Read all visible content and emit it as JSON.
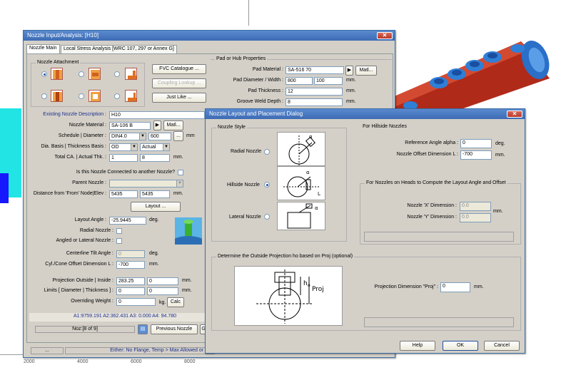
{
  "background": {
    "axis_ticks": [
      "2000",
      "4000",
      "6000",
      "8000"
    ]
  },
  "nozzle_window": {
    "title": "Nozzle Input/Analysis:  [H10]",
    "tabs": [
      "Nozzle Main",
      "Local Stress Analysis [WRC 107, 297 or Annex G]"
    ],
    "attachment_group": "Nozzle Attachment",
    "buttons": {
      "fvc": "FVC Catalogue ...",
      "coupling": "Coupling Lookup ...",
      "just_like": "Just Like ...",
      "layout": "Layout ...",
      "calc": "Calc",
      "prev": "Previous Nozzle",
      "next_partial": "Go",
      "matl": "Matl...",
      "ellipsis": "..."
    },
    "pad_group": "Pad or Hub Properties",
    "pad_material_label": "Pad Material :",
    "pad_material_value": "SA-516 70",
    "pad_diameter_label": "Pad Diameter / Width :",
    "pad_diameter_value": "800",
    "pad_width_value": "100",
    "pad_thickness_label": "Pad Thickness :",
    "pad_thickness_value": "12",
    "groove_label": "Groove Weld Depth :",
    "groove_value": "8",
    "unit_mm": "mm.",
    "unit_mm_short": "mm",
    "existing_label": "Existing Nozzle Description :",
    "existing_value": "H10",
    "material_label": "Nozzle Material :",
    "material_value": "SA-106 B",
    "schedule_label": "Schedule | Diameter :",
    "schedule_value": "DIN4.0",
    "diameter_value": "600",
    "dia_basis_label": "Dia. Basis | Thickness Basis :",
    "dia_basis_value": "OD",
    "thk_basis_value": "Actual",
    "total_ca_label": "Total CA. | Actual Thk. :",
    "total_ca_value": "1",
    "actual_thk_value": "8",
    "connected_label": "Is this Nozzle Connected to another Nozzle?",
    "parent_label": "Parent Nozzle :",
    "distance_label": "Distance from 'From' Node|Elev :",
    "distance_value": "5435",
    "elev_value": "5435",
    "layout_angle_label": "Layout Angle :",
    "layout_angle_value": "-25.9445",
    "deg": "deg.",
    "radial_label": "Radial Nozzle :",
    "angled_label": "Angled or Lateral Nozzle :",
    "tilt_label": "Centerline Tilt Angle :",
    "tilt_value": "0",
    "cyl_offset_label": "Cyl./Cone Offset Dimension L :",
    "cyl_offset_value": "-700",
    "proj_label": "Projection Outside | Inside :",
    "proj_out_value": "283.25",
    "proj_in_value": "0",
    "limits_label": "Limits [ Diameter | Thickness ] :",
    "limits_d_value": "0",
    "limits_t_value": "0",
    "weight_label": "Overriding Weight :",
    "weight_value": "0",
    "kg": "kg.",
    "areas": "A1:9759.191   A2:362.431   A3: 0.000   A4: 94.780",
    "noz_index": "Noz:[8 of 9]",
    "status_left": "...",
    "status_msg": "Either: No Flange, Temp > Max Allowed or Da"
  },
  "layout_dialog": {
    "title": "Nozzle Layout and Placement Dialog",
    "style_group": "Nozzle Style",
    "radial": "Radial Nozzle",
    "hillside": "Hillside Nozzle",
    "lateral": "Lateral Nozzle",
    "hillside_group": "For Hillside Nozzles",
    "ref_angle_label": "Reference Angle alpha :",
    "ref_angle_value": "0",
    "deg": "deg.",
    "offset_label": "Nozzle Offset Dimension L :",
    "offset_value": "-700",
    "mm": "mm.",
    "heads_group": "For Nozzles on Heads to Compute the Layout Angle and Offset",
    "x_dim_label": "Nozzle 'X' Dimension :",
    "x_dim_value": "0.0",
    "y_dim_label": "Nozzle 'Y' Dimension :",
    "y_dim_value": "0.0",
    "projection_group": "Determine the Outside Projection ho based  on Proj (optional)",
    "proj_dim_label": "Projection Dimension \"Proj\" :",
    "proj_dim_value": "0",
    "diagram_ho": "h",
    "diagram_sub": "o",
    "diagram_proj": "Proj",
    "alpha": "α",
    "L": "L",
    "help": "Help",
    "ok": "OK",
    "cancel": "Cancel"
  }
}
